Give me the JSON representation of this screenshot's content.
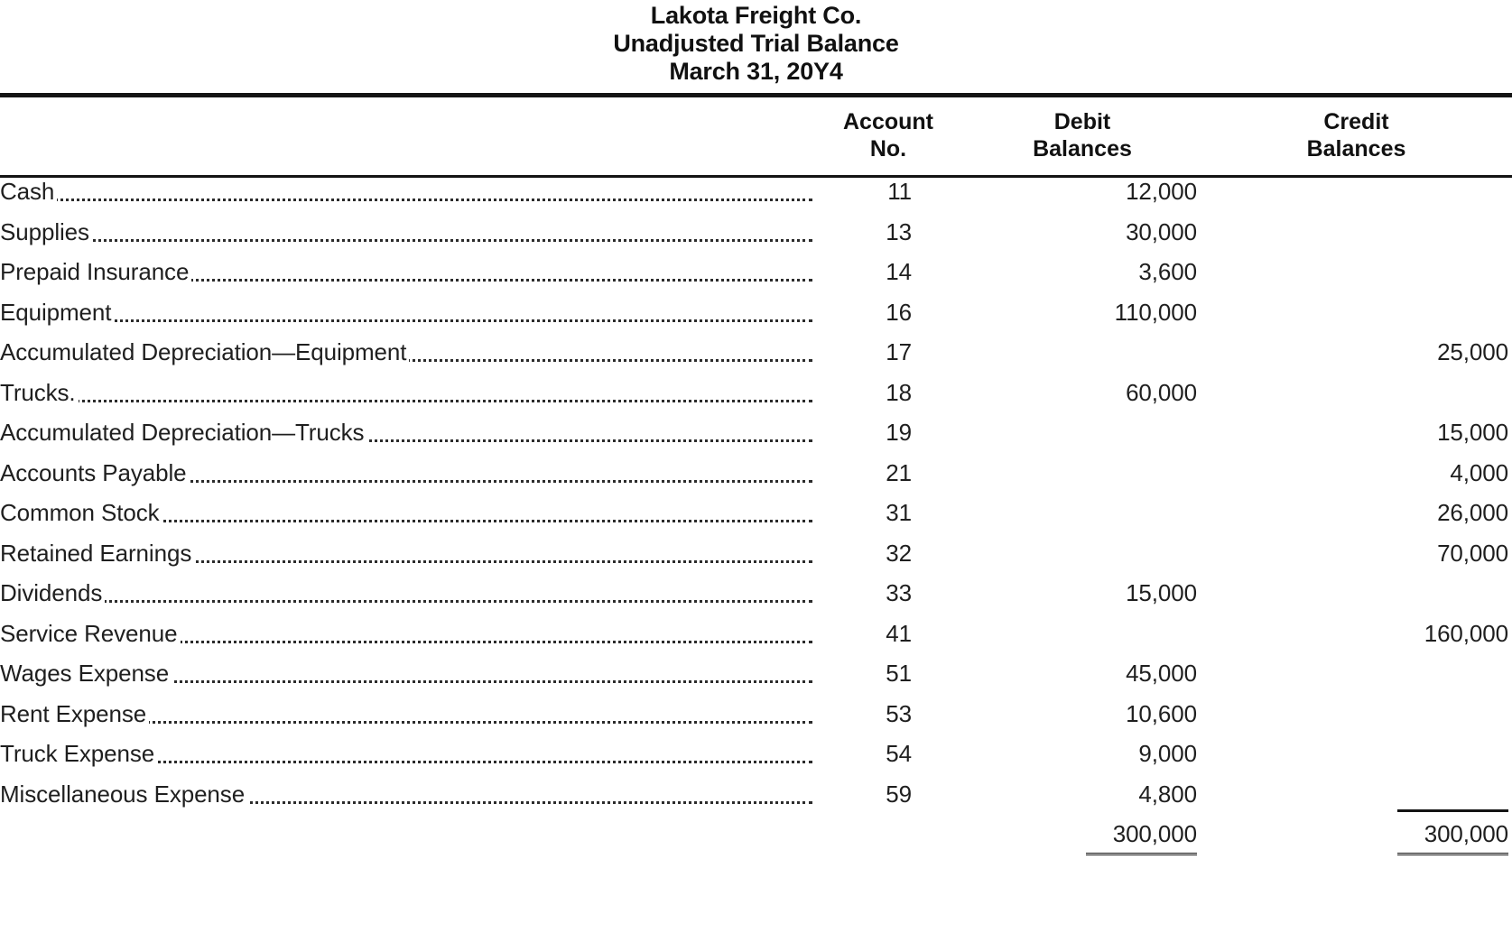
{
  "document": {
    "title_lines": [
      "Lakota Freight Co.",
      "Unadjusted Trial Balance",
      "March 31, 20Y4"
    ]
  },
  "table": {
    "headers": {
      "account_name": "",
      "account_no_line1": "Account",
      "account_no_line2": "No.",
      "debit_line1": "Debit",
      "debit_line2": "Balances",
      "credit_line1": "Credit",
      "credit_line2": "Balances"
    },
    "rows": [
      {
        "name": "Cash",
        "acct_no": "11",
        "debit": "12,000",
        "credit": ""
      },
      {
        "name": "Supplies ",
        "acct_no": "13",
        "debit": "30,000",
        "credit": ""
      },
      {
        "name": "Prepaid Insurance",
        "acct_no": "14",
        "debit": "3,600",
        "credit": ""
      },
      {
        "name": "Equipment ",
        "acct_no": "16",
        "debit": "110,000",
        "credit": ""
      },
      {
        "name": "Accumulated Depreciation—Equipment",
        "acct_no": "17",
        "debit": "",
        "credit": "25,000"
      },
      {
        "name": "Trucks.",
        "acct_no": "18",
        "debit": "60,000",
        "credit": ""
      },
      {
        "name": "Accumulated Depreciation—Trucks ",
        "acct_no": "19",
        "debit": "",
        "credit": "15,000"
      },
      {
        "name": "Accounts Payable ",
        "acct_no": "21",
        "debit": "",
        "credit": "4,000"
      },
      {
        "name": "Common Stock ",
        "acct_no": "31",
        "debit": "",
        "credit": "26,000"
      },
      {
        "name": "Retained Earnings ",
        "acct_no": "32",
        "debit": "",
        "credit": "70,000"
      },
      {
        "name": "Dividends",
        "acct_no": "33",
        "debit": "15,000",
        "credit": ""
      },
      {
        "name": "Service Revenue ",
        "acct_no": "41",
        "debit": "",
        "credit": "160,000"
      },
      {
        "name": "Wages Expense ",
        "acct_no": "51",
        "debit": "45,000",
        "credit": ""
      },
      {
        "name": "Rent Expense",
        "acct_no": "53",
        "debit": "10,600",
        "credit": ""
      },
      {
        "name": "Truck Expense ",
        "acct_no": "54",
        "debit": "9,000",
        "credit": ""
      },
      {
        "name": "Miscellaneous Expense",
        "acct_no": "59",
        "debit": "4,800",
        "credit": ""
      }
    ],
    "totals": {
      "name": "",
      "acct_no": "",
      "debit": "300,000",
      "credit": "300,000"
    }
  }
}
